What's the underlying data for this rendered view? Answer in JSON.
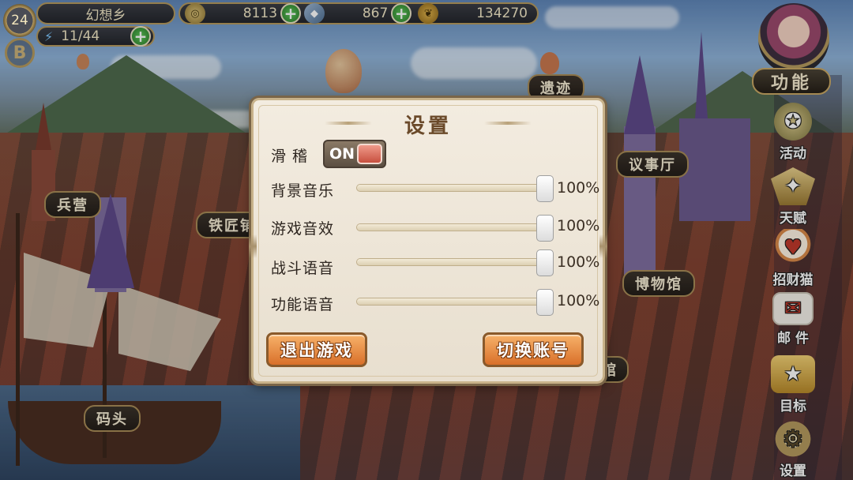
{
  "hud": {
    "level": "24",
    "location": "幻想乡",
    "energy": "11/44",
    "gold": "8113",
    "gems": "867",
    "feathers": "134270"
  },
  "map_labels": {
    "ruins": "遗迹",
    "council_hall": "议事厅",
    "barracks": "兵营",
    "blacksmith": "铁匠铺",
    "museum": "博物馆",
    "dock": "码头",
    "hidden_hall": "馆"
  },
  "right_menu": {
    "function": "功能",
    "activity": "活动",
    "talent": "天赋",
    "lucky_cat": "招财猫",
    "mail": "邮 件",
    "goal": "目标",
    "settings": "设置"
  },
  "settings": {
    "title": "设置",
    "funny_label": "滑 稽",
    "funny_toggle": "ON",
    "sliders": [
      {
        "label": "背景音乐",
        "value": "100%",
        "fraction": 1.0
      },
      {
        "label": "游戏音效",
        "value": "100%",
        "fraction": 1.0
      },
      {
        "label": "战斗语音",
        "value": "100%",
        "fraction": 1.0
      },
      {
        "label": "功能语音",
        "value": "100%",
        "fraction": 1.0
      }
    ],
    "quit_button": "退出游戏",
    "switch_account_button": "切换账号"
  },
  "colors": {
    "accent_orange": "#d9702a",
    "plus_green": "#2a7d2a",
    "toggle_knob": "#c8503f"
  }
}
